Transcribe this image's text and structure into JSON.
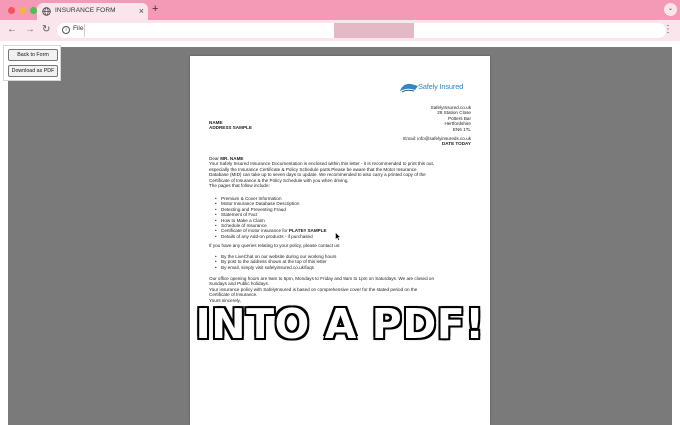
{
  "tab": {
    "title": "INSURANCE FORM",
    "close": "×",
    "new_tab": "+",
    "menu": "⌄"
  },
  "toolbar": {
    "back": "←",
    "forward": "→",
    "reload": "↻",
    "info": "i",
    "file_label": "File",
    "menu": "⋮"
  },
  "sidepanel": {
    "back_label": "Back to Form",
    "pdf_label": "Download as PDF"
  },
  "letter": {
    "logo_text": "Safely Insured",
    "company_address": [
      "SafelyInsured.co.uk",
      "28 Station Close",
      "Potters Bar",
      "Hertfordshire",
      "EN6 1TL"
    ],
    "email_line": "Email: info@safelyinsureds.co.uk",
    "date_line": "DATE TODAY",
    "recipient_name": "NAME",
    "recipient_address": "ADDRESS SAMPLE",
    "greeting_prefix": "Dear ",
    "greeting_name": "MR. NAME",
    "intro_lines": [
      "Your Safely Insured Insurance Documentation is enclosed within this letter - it is recommended to print this out,",
      "especially the Insurance Certificate & Policy Schedule parts.Please be aware that the Motor Insurance",
      "Database (MID) can take up to seven days to update. We recommended to also carry a printed copy of the",
      "Certificate of Insurance & the Policy Schedule with you when driving.",
      "The pages that follow include:"
    ],
    "pages_list": [
      "Premium & Cover Information",
      "Motor Insurance Database Description",
      "Detecting and Preventing Fraud",
      "Statement of Fact",
      "How to Make a Claim",
      "Schedule of Insurance"
    ],
    "plate_item_prefix": "Certificate of motor insurance for ",
    "plate_item_bold": "PLATE# SAMPLE",
    "addons_item": "Details of any Add-on products - if purchased",
    "queries_line": "If you have any queries relating to your policy, please contact us:",
    "contact_list": [
      "By the LiveChat on our website during our working hours",
      "By post to the address shown at the top of this letter",
      "By email, simply visit safelyinsured.co.uk/faqs"
    ],
    "closing_lines": [
      "Our office opening hours are 9am to 5pm, Mondays to Friday and 9am to 1pm on Saturdays. We are closed on",
      "Sundays and Public holidays.",
      "Your insurance policy with SafelyInsured is based on comprehensive cover for the stated period on the",
      "Certificate of Insurance.",
      "Yours sincerely,"
    ]
  },
  "overlay_text": "INTO A PDF!"
}
